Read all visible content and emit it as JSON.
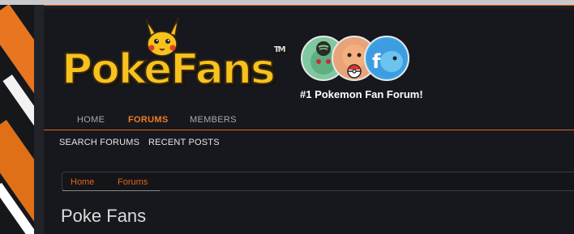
{
  "site": {
    "logo_text": "PokeFans",
    "logo_trademark": "TM",
    "tagline": "#1 Pokemon Fan Forum!"
  },
  "social_icons": [
    "spotify-icon",
    "pokeball-icon",
    "facebook-icon"
  ],
  "nav": {
    "items": [
      {
        "label": "HOME",
        "active": false
      },
      {
        "label": "FORUMS",
        "active": true
      },
      {
        "label": "MEMBERS",
        "active": false
      }
    ]
  },
  "subnav": {
    "items": [
      {
        "label": "SEARCH FORUMS"
      },
      {
        "label": "RECENT POSTS"
      }
    ]
  },
  "breadcrumb": {
    "items": [
      {
        "label": "Home"
      },
      {
        "label": "Forums"
      }
    ]
  },
  "page": {
    "title": "Poke Fans"
  },
  "colors": {
    "accent": "#f07d22",
    "logo_yellow": "#f7c21e",
    "background": "#17181d"
  }
}
